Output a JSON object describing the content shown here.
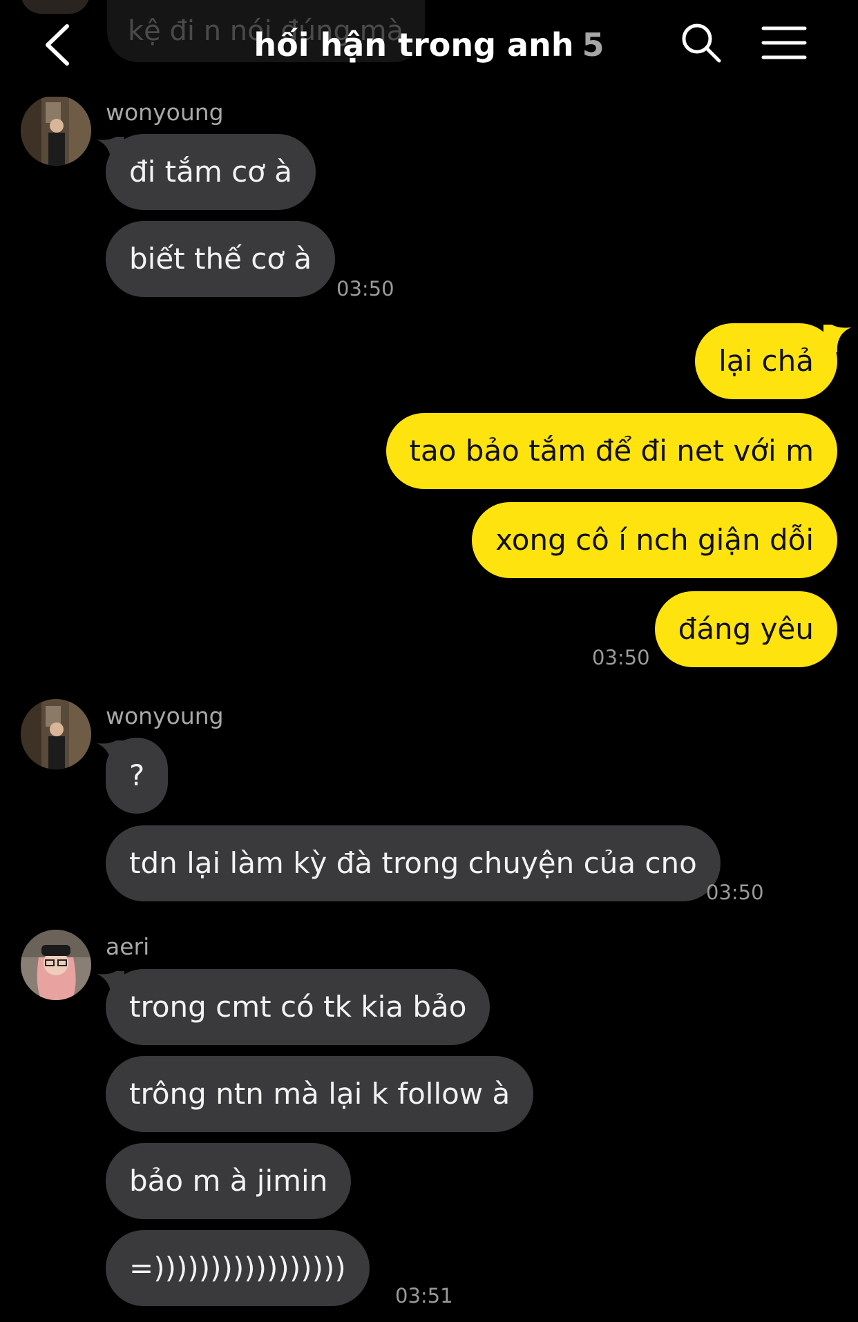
{
  "header": {
    "ghost_message": "kệ đi n nói đúng mà",
    "title": "hối hận trong anh",
    "member_count": "5"
  },
  "messages": {
    "g1_name": "wonyoung",
    "m1": "đi tắm cơ à",
    "m2": "biết thế cơ à",
    "t1": "03:50",
    "m3": "lại chả",
    "m4": "tao bảo tắm để đi net với m",
    "m5": "xong cô í nch giận dỗi",
    "m6": "đáng yêu",
    "t2": "03:50",
    "g2_name": "wonyoung",
    "m7": "?",
    "m8": "tdn lại làm kỳ đà trong chuyện của cno",
    "t3": "03:50",
    "g3_name": "aeri",
    "m9": "trong cmt có tk kia bảo",
    "m10": "trông ntn mà lại k follow à",
    "m11": "bảo m à jimin",
    "m12": "=)))))))))))))))))",
    "t4": "03:51"
  },
  "colors": {
    "background": "#000000",
    "incoming_bubble": "#3a3a3c",
    "outgoing_bubble": "#ffe30f",
    "secondary_text": "#a8a8a8"
  },
  "icons": [
    "back-chevron-icon",
    "search-icon",
    "menu-icon"
  ]
}
